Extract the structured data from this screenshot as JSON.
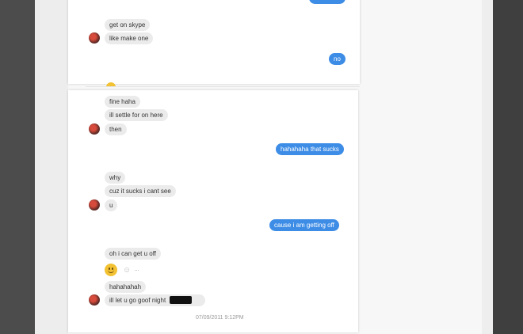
{
  "conversation": {
    "section1": {
      "messages": [
        {
          "dir": "in",
          "text": "get on skype"
        },
        {
          "dir": "in",
          "text": "like make one"
        },
        {
          "dir": "out",
          "text": "no"
        }
      ]
    },
    "section2": {
      "messages": [
        {
          "dir": "in",
          "text": "fine haha"
        },
        {
          "dir": "in",
          "text": "ill settle for on here"
        },
        {
          "dir": "in",
          "text": "then"
        },
        {
          "dir": "out",
          "text": "hahahaha that sucks"
        },
        {
          "dir": "in",
          "text": "why"
        },
        {
          "dir": "in",
          "text": "cuz it sucks i cant see"
        },
        {
          "dir": "in",
          "text": "u"
        },
        {
          "dir": "out",
          "text": "cause i am getting off"
        },
        {
          "dir": "in",
          "text": "oh i can get u off"
        },
        {
          "dir": "in",
          "text": "hahahahah"
        },
        {
          "dir": "in",
          "text": "ill let u go goof  night"
        }
      ],
      "timestamp": "07/09/2011 9:12PM"
    }
  },
  "colors": {
    "outgoing_bubble": "#3d8ce6",
    "incoming_bubble": "#ebebeb"
  },
  "icons": [
    "avatar",
    "smiley-emoji-icon",
    "reaction-icon",
    "more-options-icon",
    "redaction-bar"
  ]
}
